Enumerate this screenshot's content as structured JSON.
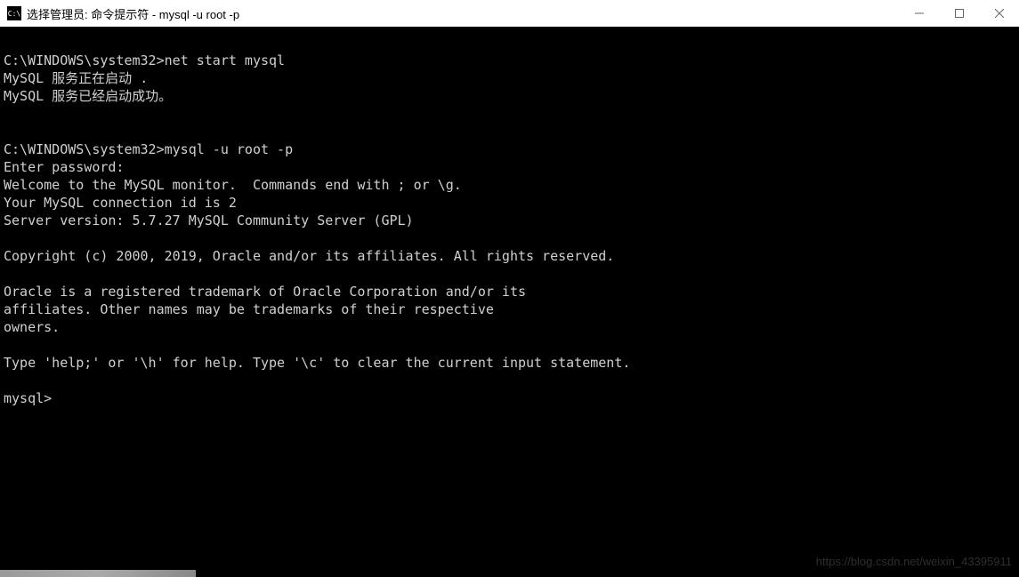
{
  "titlebar": {
    "icon_label": "C:\\",
    "title": "选择管理员: 命令提示符 - mysql  -u root -p"
  },
  "terminal": {
    "lines": [
      "",
      "C:\\WINDOWS\\system32>net start mysql",
      "MySQL 服务正在启动 .",
      "MySQL 服务已经启动成功。",
      "",
      "",
      "C:\\WINDOWS\\system32>mysql -u root -p",
      "Enter password:",
      "Welcome to the MySQL monitor.  Commands end with ; or \\g.",
      "Your MySQL connection id is 2",
      "Server version: 5.7.27 MySQL Community Server (GPL)",
      "",
      "Copyright (c) 2000, 2019, Oracle and/or its affiliates. All rights reserved.",
      "",
      "Oracle is a registered trademark of Oracle Corporation and/or its",
      "affiliates. Other names may be trademarks of their respective",
      "owners.",
      "",
      "Type 'help;' or '\\h' for help. Type '\\c' to clear the current input statement.",
      "",
      "mysql>"
    ]
  },
  "watermark": "https://blog.csdn.net/weixin_43395911"
}
